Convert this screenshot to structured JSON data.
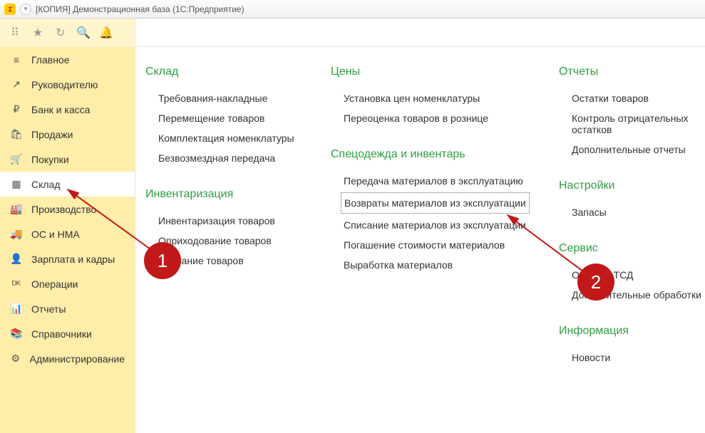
{
  "window": {
    "logo_text": "1҃",
    "title": "[КОПИЯ] Демонстрационная база  (1С:Предприятие)"
  },
  "toolbar_icons": [
    "grid-icon",
    "star-icon",
    "history-icon",
    "search-icon",
    "bell-icon"
  ],
  "sidebar": {
    "items": [
      {
        "icon": "≡",
        "label": "Главное",
        "name": "nav-main"
      },
      {
        "icon": "↗",
        "label": "Руководителю",
        "name": "nav-manager"
      },
      {
        "icon": "₽",
        "label": "Банк и касса",
        "name": "nav-bank"
      },
      {
        "icon": "🛍",
        "label": "Продажи",
        "name": "nav-sales"
      },
      {
        "icon": "🛒",
        "label": "Покупки",
        "name": "nav-purchases"
      },
      {
        "icon": "▦",
        "label": "Склад",
        "name": "nav-warehouse"
      },
      {
        "icon": "🏭",
        "label": "Производство",
        "name": "nav-production"
      },
      {
        "icon": "🚚",
        "label": "ОС и НМА",
        "name": "nav-assets"
      },
      {
        "icon": "👤",
        "label": "Зарплата и кадры",
        "name": "nav-hr"
      },
      {
        "icon": "ᴰᴷ",
        "label": "Операции",
        "name": "nav-operations"
      },
      {
        "icon": "📊",
        "label": "Отчеты",
        "name": "nav-reports"
      },
      {
        "icon": "📚",
        "label": "Справочники",
        "name": "nav-catalogs"
      },
      {
        "icon": "⚙",
        "label": "Администрирование",
        "name": "nav-admin"
      }
    ],
    "active_index": 5
  },
  "content": {
    "col1": [
      {
        "head": "Склад",
        "links": [
          "Требования-накладные",
          "Перемещение товаров",
          "Комплектация номенклатуры",
          "Безвозмездная передача"
        ]
      },
      {
        "head": "Инвентаризация",
        "links": [
          "Инвентаризация товаров",
          "Оприходование товаров",
          "Списание товаров"
        ]
      }
    ],
    "col2": [
      {
        "head": "Цены",
        "links": [
          "Установка цен номенклатуры",
          "Переоценка товаров в рознице"
        ]
      },
      {
        "head": "Спецодежда и инвентарь",
        "links": [
          "Передача материалов в эксплуатацию",
          "Возвраты материалов из эксплуатации",
          "Списание материалов из эксплуатации",
          "Погашение стоимости материалов",
          "Выработка материалов"
        ],
        "boxed_index": 1
      }
    ],
    "col3": [
      {
        "head": "Отчеты",
        "links": [
          "Остатки товаров",
          "Контроль отрицательных остатков",
          "Дополнительные отчеты"
        ]
      },
      {
        "head": "Настройки",
        "links": [
          "Запасы"
        ]
      },
      {
        "head": "Сервис",
        "links": [
          "Обмен с ТСД",
          "Дополнительные обработки"
        ]
      },
      {
        "head": "Информация",
        "links": [
          "Новости"
        ]
      }
    ]
  },
  "annotations": {
    "badge1": "1",
    "badge2": "2"
  }
}
